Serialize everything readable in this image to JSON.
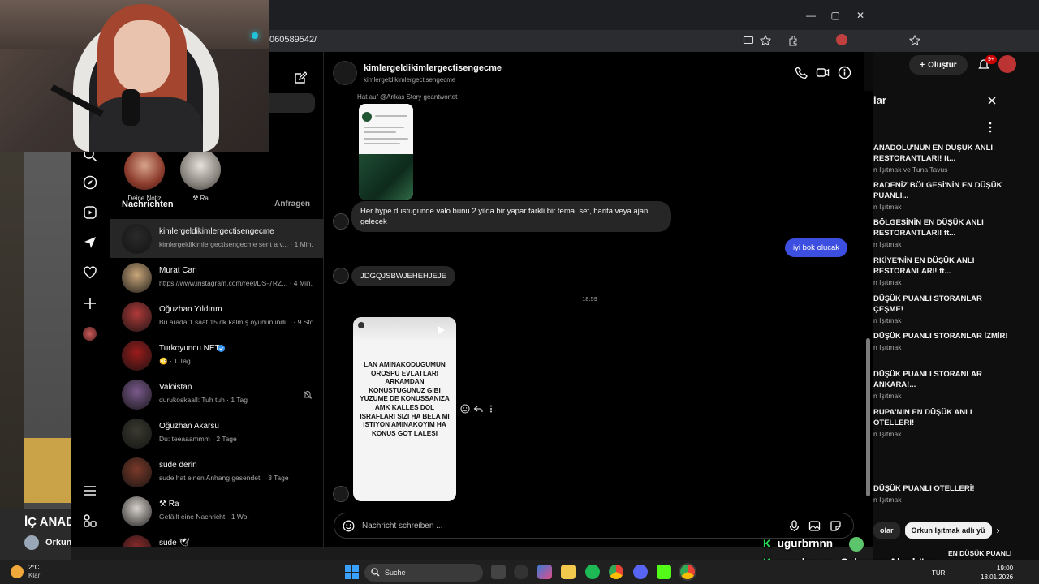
{
  "browser": {
    "url_fragment": "060589542/",
    "right_window_create_button": "Oluştur",
    "right_window_notif_badge": "9+"
  },
  "instagram": {
    "notes": [
      {
        "label": "Deine Notiz"
      },
      {
        "label": "⚒ Ra"
      }
    ],
    "section_title": "Nachrichten",
    "requests_label": "Anfragen",
    "conversations": [
      {
        "name": "kimlergeldikimlergectisengecme",
        "preview": "kimlergeldikimlergectisengecme sent a v... · 1 Min.",
        "active": true,
        "color": "#2a2a2a"
      },
      {
        "name": "Murat Can",
        "preview": "https://www.instagram.com/reel/DS-7RZ... · 4 Min.",
        "color": "#c9a77a"
      },
      {
        "name": "Oğuzhan Yıldırım",
        "preview": "Bu arada 1 saat 15 dk kalmış oyunun indi... · 9 Std.",
        "color": "#b03a3a"
      },
      {
        "name": "Turkoyuncu NET",
        "preview": "😳 · 1 Tag",
        "verified": true,
        "color": "#9b1c1c"
      },
      {
        "name": "Valoistan",
        "preview": "durukoskaall: Tuh tuh · 1 Tag",
        "muted": true,
        "color": "#7a5a8c"
      },
      {
        "name": "Oğuzhan Akarsu",
        "preview": "Du: teeaaammm · 2 Tage",
        "color": "#3a3a30"
      },
      {
        "name": "sude derin",
        "preview": "sude hat einen Anhang gesendet. · 3 Tage",
        "color": "#7a3a2a"
      },
      {
        "name": "⚒ Ra",
        "preview": "Gefällt eine Nachricht · 1 Wo.",
        "color": "#d8d2cc"
      },
      {
        "name": "sude 🕊",
        "preview": "",
        "color": "#8a2a2a"
      }
    ],
    "chat": {
      "name": "kimlergeldikimlergectisengecme",
      "username": "kimlergeldikimlergectisengecme",
      "story_reply_label": "Hat auf @Ankas Story geantwortet",
      "msg_in_1": "Her hype dustugunde valo bunu 2 yilda bir yapar farkli bir tema, set, harita veya ajan gelecek",
      "msg_out_1": "iyi bok olucak",
      "msg_in_2": "JDGQJSBWJEHEHJEJE",
      "time_separator": "18:59",
      "reel_text": "LAN AMINAKODUGUMUN OROSPU EVLATLARI ARKAMDAN KONUSTUGUNUZ GIBI YUZUME DE KONUSSANIZA AMK KALLES DOL ISRAFLARI SIZI HA BELA MI ISTIYON AMINAKOYIM HA KONUS GOT LALESI",
      "composer_placeholder": "Nachricht schreiben ..."
    }
  },
  "right_panel": {
    "title_fragment": "lar",
    "items": [
      {
        "title": "ANADOLU'NUN EN DÜŞÜK ANLI RESTORANTLARI! ft...",
        "sub": "n Işıtmak ve Tuna Tavus"
      },
      {
        "title": "RADENİZ BÖLGESİ'NİN EN DÜŞÜK PUANLI...",
        "sub": "n Işıtmak"
      },
      {
        "title": "BÖLGESİNİN EN DÜŞÜK ANLI RESTORANTLARI! ft...",
        "sub": "n Işıtmak"
      },
      {
        "title": "RKİYE'NİN EN DÜŞÜK ANLI RESTORANLARI! ft...",
        "sub": "n Işıtmak"
      },
      {
        "title": "DÜŞÜK PUANLI STORANLAR ÇEŞME!",
        "sub": "n Işıtmak"
      },
      {
        "title": "DÜŞÜK PUANLI STORANLAR İZMİR!",
        "sub": "n Işıtmak"
      },
      {
        "title": "DÜŞÜK PUANLI STORANLAR ANKARA!...",
        "sub": "n Işıtmak"
      },
      {
        "title": "RUPA'NIN EN DÜŞÜK ANLI OTELLERİ!",
        "sub": "n Işıtmak"
      },
      {
        "title": "DÜŞÜK PUANLI OTELLERİ!",
        "sub": "n Işıtmak"
      }
    ],
    "chips": [
      "olar",
      "Orkun Işıtmak adlı yü"
    ],
    "bottom_item": "EN DÜŞÜK PUANLI"
  },
  "stream_overlay": {
    "left_caption": "İÇ ANADO",
    "left_user": "Orkun",
    "chat_lines": [
      {
        "user": "ugurbrnnn",
        "text": ""
      },
      {
        "user": "ugurbrnnn",
        "text": "Selamun Aleyküm"
      }
    ]
  },
  "taskbar": {
    "weather_temp": "2°C",
    "weather_desc": "Klar",
    "search_label": "Suche",
    "lang": "TUR",
    "time": "19:00",
    "date": "18.01.2026"
  }
}
